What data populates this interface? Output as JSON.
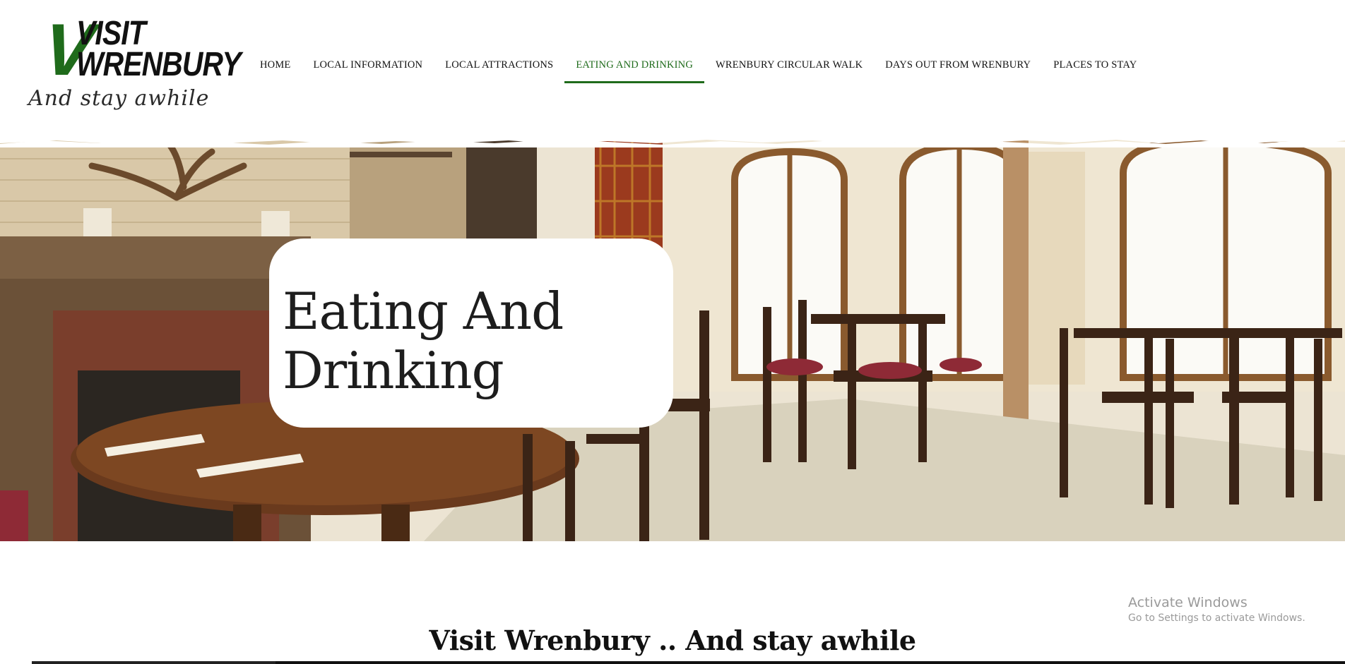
{
  "logo": {
    "letter": "V",
    "line1": "VISIT",
    "line2": "WRENBURY",
    "tagline": "And stay awhile"
  },
  "nav": {
    "items": [
      {
        "label": "HOME"
      },
      {
        "label": "LOCAL INFORMATION"
      },
      {
        "label": "LOCAL ATTRACTIONS"
      },
      {
        "label": "EATING AND DRINKING",
        "active": true
      },
      {
        "label": "WRENBURY CIRCULAR WALK"
      },
      {
        "label": "DAYS OUT FROM WRENBURY"
      },
      {
        "label": "PLACES TO STAY"
      }
    ]
  },
  "hero": {
    "title_line1": "Eating And",
    "title_line2": "Drinking",
    "image_subject": "pub-dining-room"
  },
  "intro": {
    "heading": "Visit Wrenbury .. And stay awhile"
  },
  "watermark": {
    "title": "Activate Windows",
    "subtitle": "Go to Settings to activate Windows."
  },
  "colors": {
    "accent": "#1f6b1b",
    "text": "#111111",
    "background": "#ffffff"
  }
}
